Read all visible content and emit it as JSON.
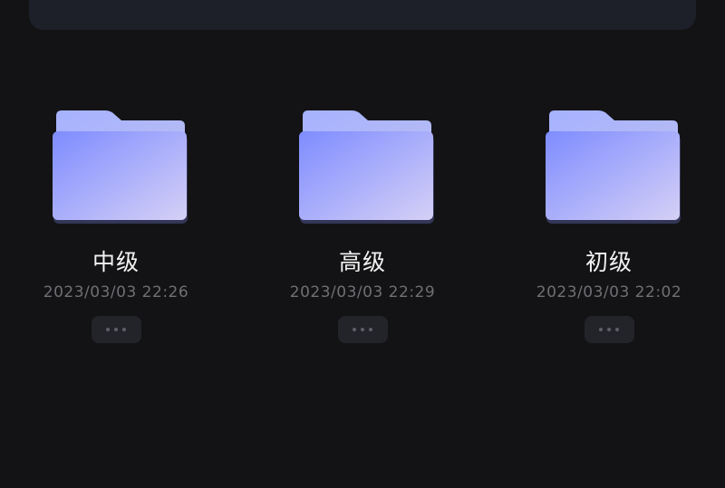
{
  "folders": [
    {
      "name": "中级",
      "date": "2023/03/03 22:26"
    },
    {
      "name": "高级",
      "date": "2023/03/03 22:29"
    },
    {
      "name": "初级",
      "date": "2023/03/03 22:02"
    }
  ],
  "colors": {
    "background": "#131315",
    "banner": "#1d1f29",
    "folder_front_start": "#7e8cff",
    "folder_front_end": "#d5d0f6",
    "folder_back": "#a9b4fb",
    "name_text": "#f2f2f2",
    "date_text": "#6f6f74",
    "more_button": "#23242a"
  },
  "icons": {
    "folder": "folder-icon",
    "more": "more-dots-icon"
  }
}
